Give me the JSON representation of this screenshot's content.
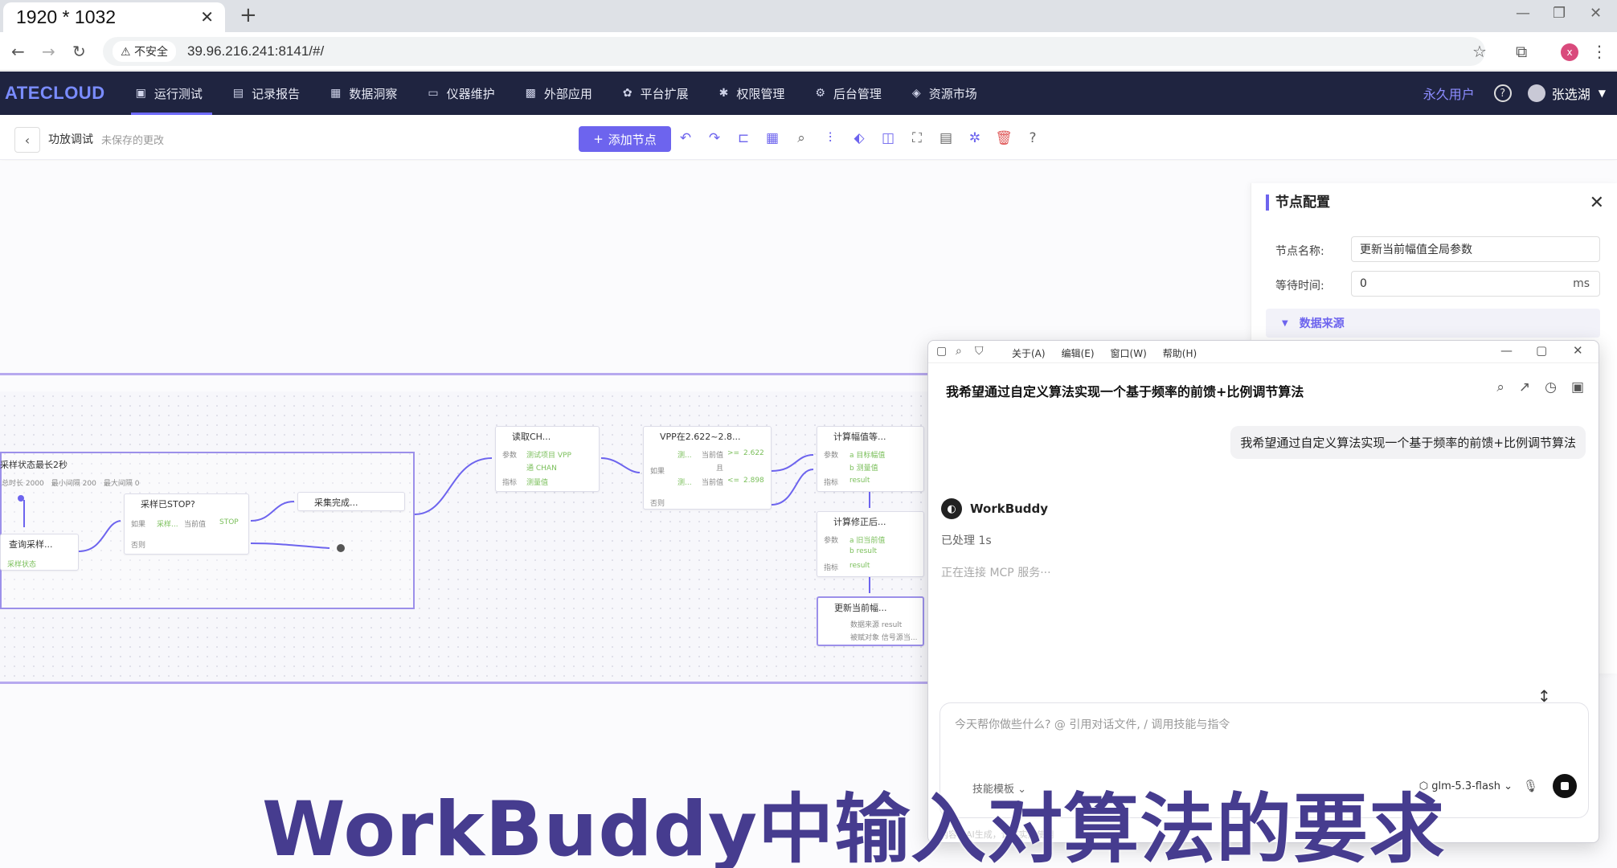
{
  "browser": {
    "tab_title": "1920 * 1032",
    "security": "不安全",
    "url": "39.96.216.241:8141/#/"
  },
  "app": {
    "logo": "ATECLOUD",
    "nav": [
      {
        "label": "运行测试",
        "icon": "monitor-icon"
      },
      {
        "label": "记录报告",
        "icon": "report-icon"
      },
      {
        "label": "数据洞察",
        "icon": "chart-icon"
      },
      {
        "label": "仪器维护",
        "icon": "instrument-icon"
      },
      {
        "label": "外部应用",
        "icon": "grid-icon"
      },
      {
        "label": "平台扩展",
        "icon": "extension-icon"
      },
      {
        "label": "权限管理",
        "icon": "permission-icon"
      },
      {
        "label": "后台管理",
        "icon": "admin-icon"
      },
      {
        "label": "资源市场",
        "icon": "market-icon"
      }
    ],
    "vip_label": "永久用户",
    "user_name": "张选湖"
  },
  "toolbar": {
    "crumb": "功放调试",
    "unsaved": "未保存的更改",
    "add_node": "添加节点"
  },
  "canvas": {
    "nodes": {
      "group_title": "采样状态最长2秒",
      "group_meta": [
        "总时长 2000",
        "最小间隔 200",
        "最大间隔 0"
      ],
      "query": "查询采样...",
      "query_sub": "采样状态",
      "stop_check": "采样已STOP?",
      "stop_if": "如果",
      "stop_cond": [
        "采样...",
        "当前值",
        "STOP"
      ],
      "stop_else": "否则",
      "done": "采集完成...",
      "read": "读取CH...",
      "read_rows": [
        "参数",
        "测试项目 VPP",
        "通 CHAN",
        "指标",
        "测量值"
      ],
      "vpp": "VPP在2.622~2.8...",
      "vpp_if": "如果",
      "vpp_cond1": [
        "测...",
        "当前值",
        ">=",
        "2.622"
      ],
      "vpp_and": "且",
      "vpp_cond2": [
        "测...",
        "当前值",
        "<=",
        "2.898"
      ],
      "vpp_else": "否则",
      "calc1": "计算幅值等...",
      "calc1_rows": [
        "参数",
        "a 目标幅值",
        "b 测量值",
        "指标",
        "result"
      ],
      "calc2": "计算修正后...",
      "calc2_rows": [
        "参数",
        "a 旧当前值",
        "b result",
        "指标",
        "result"
      ],
      "update": "更新当前幅...",
      "update_rows": [
        "数据来源 result",
        "被赋对象 信号源当..."
      ]
    }
  },
  "config": {
    "title": "节点配置",
    "name_label": "节点名称:",
    "name_value": "更新当前幅值全局参数",
    "wait_label": "等待时间:",
    "wait_value": "0",
    "wait_unit": "ms",
    "section": "数据来源"
  },
  "workbuddy": {
    "menu": [
      "关于(A)",
      "编辑(E)",
      "窗口(W)",
      "帮助(H)"
    ],
    "title": "我希望通过自定义算法实现一个基于频率的前馈+比例调节算法",
    "user_message": "我希望通过自定义算法实现一个基于频率的前馈+比例调节算法",
    "agent_name": "WorkBuddy",
    "processed": "已处理 1s",
    "status": "正在连接 MCP 服务···",
    "placeholder": "今天帮你做些什么? @ 引用对话文件, / 调用技能与指令",
    "context_label": "技能模板",
    "model": "glm-5.3-flash",
    "bottom_hint": "内容由AI生成，请核实后使用"
  },
  "caption": "WorkBuddy中输入对算法的要求"
}
